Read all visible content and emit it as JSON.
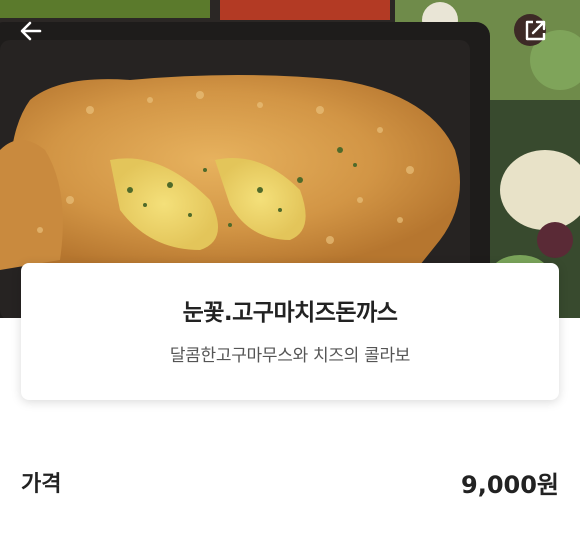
{
  "menu": {
    "name": "눈꽃.고구마치즈돈까스",
    "description": "달콤한고구마무스와 치즈의 콜라보"
  },
  "price": {
    "label": "가격",
    "value": "9,000원"
  },
  "icons": {
    "back": "back-arrow-icon",
    "share": "share-external-icon"
  }
}
